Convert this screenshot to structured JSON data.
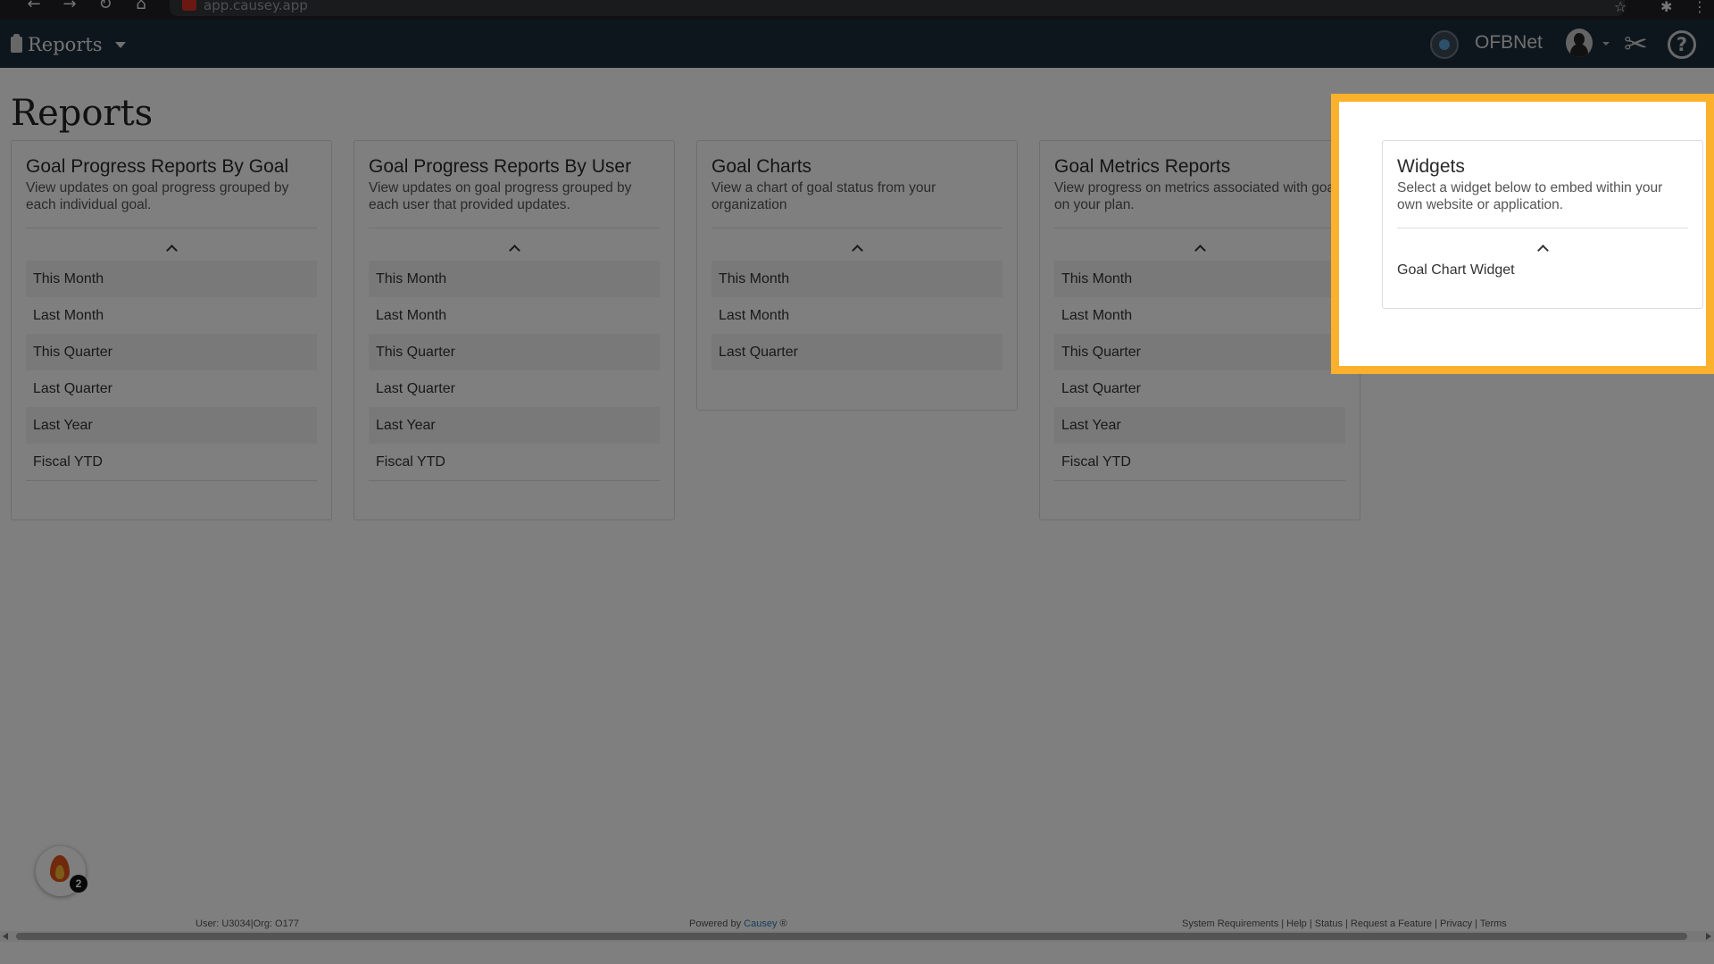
{
  "browser": {
    "url": "app.causey.app",
    "back_icon": "←",
    "forward_icon": "→",
    "reload_icon": "↻",
    "home_icon": "⌂",
    "star_icon": "☆",
    "ext_icon": "✱",
    "menu_icon": "⋮"
  },
  "nav": {
    "brand_label": "Reports",
    "org_name": "OFBNet",
    "tools_glyph": "✂",
    "help_glyph": "?"
  },
  "page": {
    "title": "Reports"
  },
  "cards": [
    {
      "title": "Goal Progress Reports By Goal",
      "description": "View updates on goal progress grouped by each individual goal.",
      "items": [
        "This Month",
        "Last Month",
        "This Quarter",
        "Last Quarter",
        "Last Year",
        "Fiscal YTD"
      ]
    },
    {
      "title": "Goal Progress Reports By User",
      "description": "View updates on goal progress grouped by each user that provided updates.",
      "items": [
        "This Month",
        "Last Month",
        "This Quarter",
        "Last Quarter",
        "Last Year",
        "Fiscal YTD"
      ]
    },
    {
      "title": "Goal Charts",
      "description": "View a chart of goal status from your organization",
      "items": [
        "This Month",
        "Last Month",
        "Last Quarter"
      ]
    },
    {
      "title": "Goal Metrics Reports",
      "description": "View progress on metrics associated with goals on your plan.",
      "items": [
        "This Month",
        "Last Month",
        "This Quarter",
        "Last Quarter",
        "Last Year",
        "Fiscal YTD"
      ]
    }
  ],
  "widgets": {
    "title": "Widgets",
    "description": "Select a widget below to embed within your own website or application.",
    "items": [
      "Goal Chart Widget"
    ]
  },
  "footer": {
    "user_info": "User: U3034|Org: O177",
    "powered_prefix": "Powered by",
    "powered_brand": "Causey",
    "powered_suffix": "®",
    "links": "System Requirements | Help | Status | Request a Feature | Privacy | Terms"
  },
  "notifications": {
    "count": "2"
  },
  "colors": {
    "highlight": "#fbb12b",
    "nav_bg": "#1c2d3a",
    "brand_link": "#2a7ab8"
  }
}
